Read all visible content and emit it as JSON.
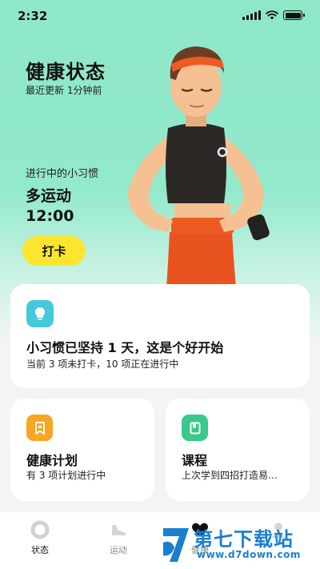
{
  "status_bar": {
    "time": "2:32"
  },
  "header": {
    "title": "健康状态",
    "subtitle": "最近更新 1分钟前"
  },
  "habit": {
    "label": "进行中的小习惯",
    "name": "多运动",
    "time": "12:00",
    "checkin_label": "打卡"
  },
  "streak_card": {
    "icon": "bulb-icon",
    "title": "小习惯已坚持 1 天，这是个好开始",
    "desc": "当前 3 项未打卡，10 项正在进行中"
  },
  "plan_card": {
    "icon": "bookmark-icon",
    "title": "健康计划",
    "desc": "有 3 项计划进行中"
  },
  "course_card": {
    "icon": "book-icon",
    "title": "课程",
    "desc": "上次学到四招打造易…"
  },
  "tabs": [
    {
      "label": "状态",
      "icon": "status-ring-icon"
    },
    {
      "label": "运动",
      "icon": "shoe-icon"
    },
    {
      "label": "健康",
      "icon": "heart-icon"
    },
    {
      "label": "",
      "icon": "profile-icon"
    }
  ],
  "watermark": {
    "text": "第七下载站",
    "url": "www.d7down.com"
  },
  "colors": {
    "hero_bg": "#8ee8c8",
    "checkin_button": "#fde52d",
    "streak_icon": "#46c9da",
    "plan_icon": "#f6a623",
    "course_icon": "#38c98b",
    "watermark": "#1a7fd1"
  }
}
